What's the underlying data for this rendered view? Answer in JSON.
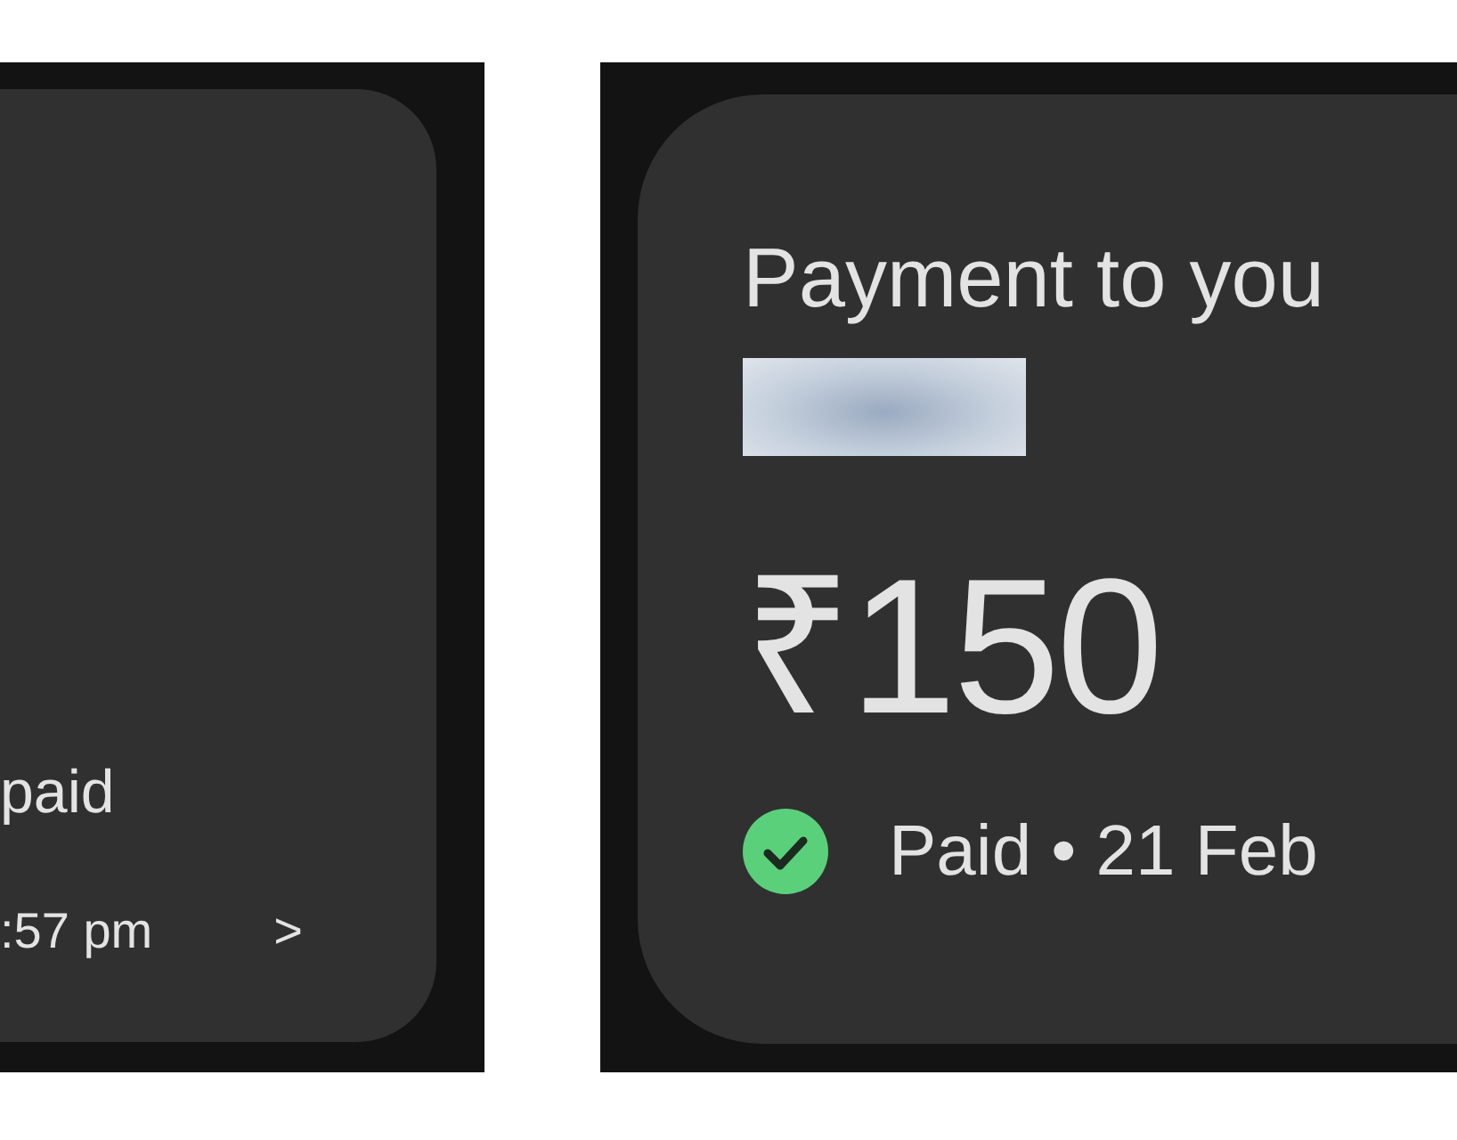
{
  "left_card": {
    "status": "paid",
    "time": ":57 pm",
    "chevron": ">"
  },
  "right_card": {
    "title": "Payment to you",
    "amount": "₹150",
    "status": {
      "paid": true,
      "text": "Paid • 21 Feb"
    }
  }
}
